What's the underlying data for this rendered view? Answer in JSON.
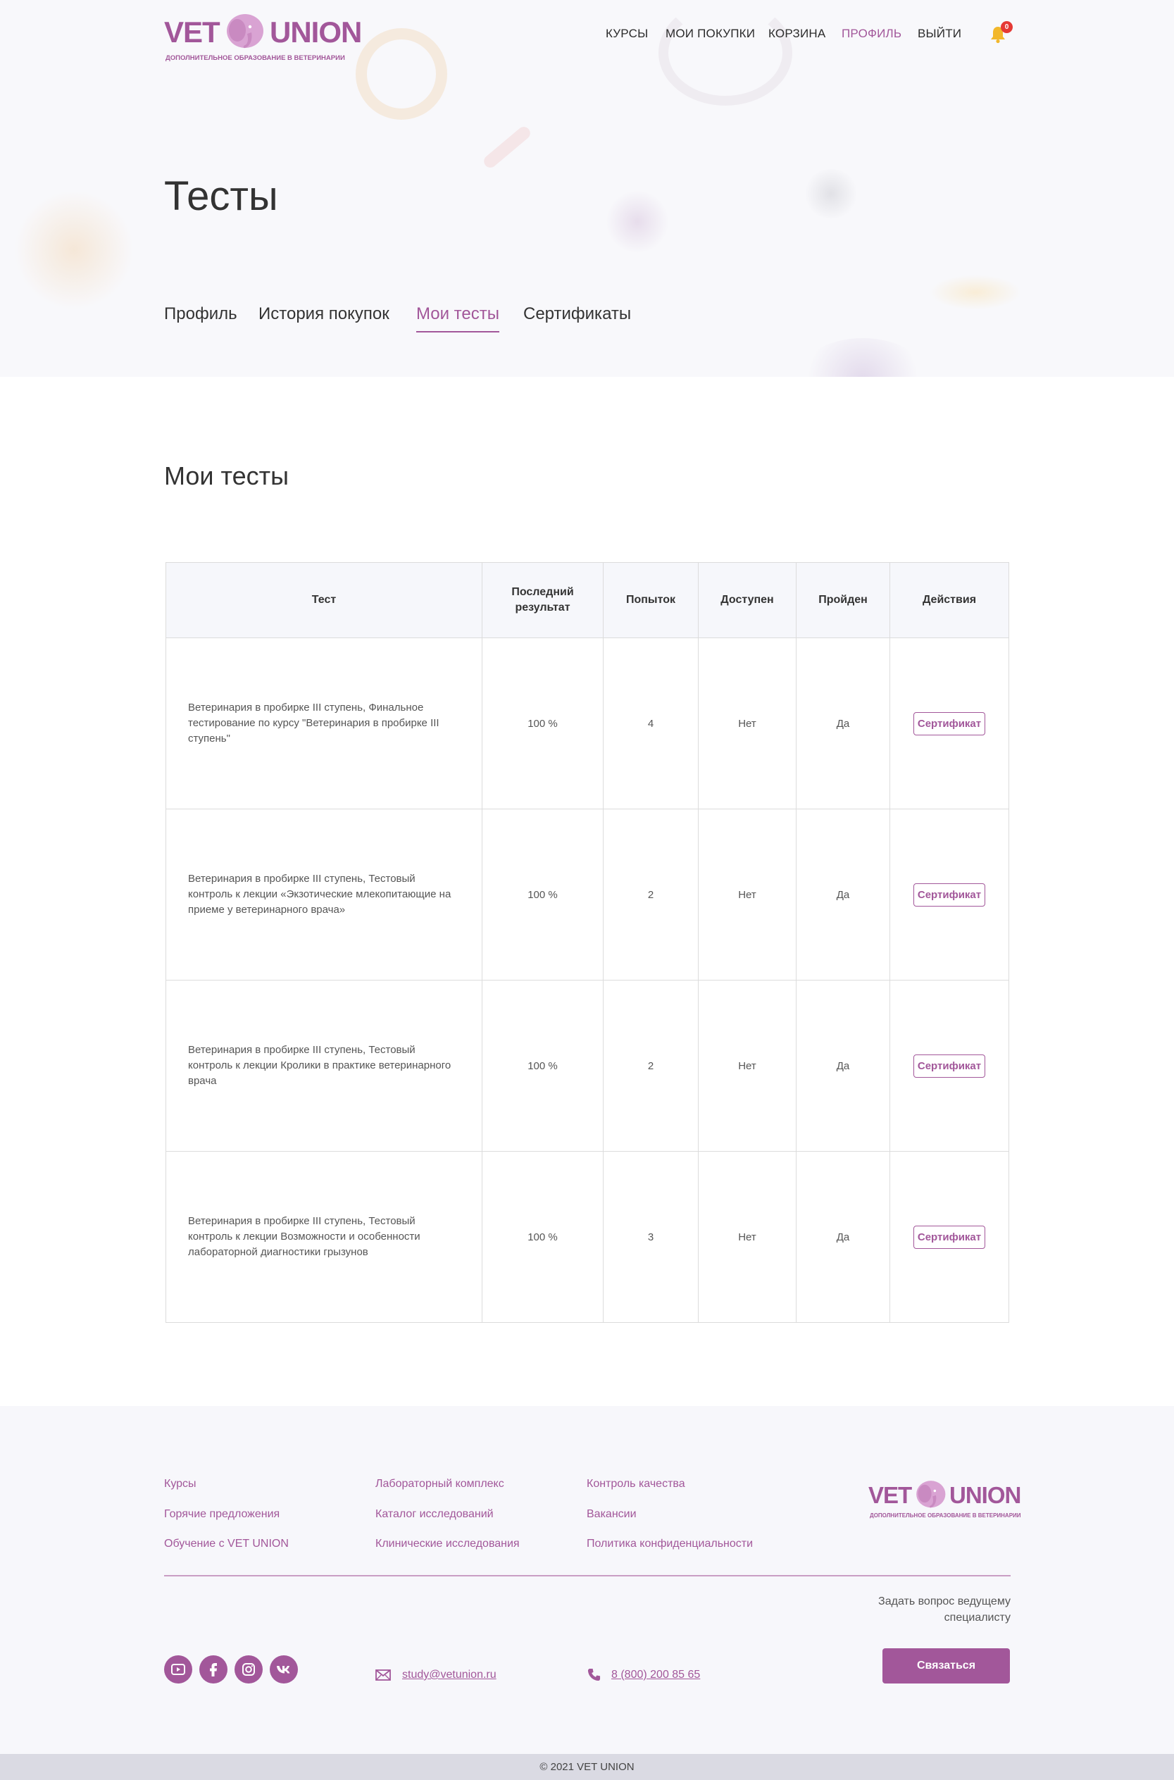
{
  "brand": {
    "logo_word_left": "VET",
    "logo_word_right": "UNION",
    "tagline": "ДОПОЛНИТЕЛЬНОЕ ОБРАЗОВАНИЕ В ВЕТЕРИНАРИИ",
    "color": "#a2579a"
  },
  "nav": {
    "items": [
      {
        "label": "КУРСЫ"
      },
      {
        "label": "МОИ ПОКУПКИ"
      },
      {
        "label": "КОРЗИНА"
      },
      {
        "label": "ПРОФИЛЬ",
        "active": true
      },
      {
        "label": "ВЫЙТИ"
      }
    ],
    "notifications": {
      "icon": "bell-icon",
      "count": "0"
    }
  },
  "page": {
    "title": "Тесты",
    "tabs": [
      {
        "label": "Профиль"
      },
      {
        "label": "История покупок"
      },
      {
        "label": "Мои тесты",
        "active": true
      },
      {
        "label": "Сертификаты"
      }
    ],
    "section_title": "Мои тесты"
  },
  "table": {
    "headers": [
      "Тест",
      "Последний результат",
      "Попыток",
      "Доступен",
      "Пройден",
      "Действия"
    ],
    "rows": [
      {
        "test": "Ветеринария в пробирке III ступень, Финальное тестирование по курсу \"Ветеринария в пробирке III ступень\"",
        "result": "100 %",
        "attempts": "4",
        "available": "Нет",
        "passed": "Да",
        "action": "Сертификат"
      },
      {
        "test": "Ветеринария в пробирке III ступень, Тестовый контроль к лекции «Экзотические млекопитающие на приеме у ветеринарного врача»",
        "result": "100 %",
        "attempts": "2",
        "available": "Нет",
        "passed": "Да",
        "action": "Сертификат"
      },
      {
        "test": "Ветеринария в пробирке III ступень, Тестовый контроль к лекции Кролики в практике ветеринарного врача",
        "result": "100 %",
        "attempts": "2",
        "available": "Нет",
        "passed": "Да",
        "action": "Сертификат"
      },
      {
        "test": "Ветеринария в пробирке III ступень, Тестовый контроль к лекции Возможности и особенности лабораторной диагностики грызунов",
        "result": "100 %",
        "attempts": "3",
        "available": "Нет",
        "passed": "Да",
        "action": "Сертификат"
      }
    ]
  },
  "footer": {
    "col1": [
      "Курсы",
      "Горячие предложения",
      "Обучение с VET UNION"
    ],
    "col2": [
      "Лабораторный комплекс",
      "Каталог исследований",
      "Клинические исследования"
    ],
    "col3": [
      "Контроль качества",
      "Вакансии",
      "Политика конфиденциальности"
    ],
    "ask_text": "Задать вопрос ведущему специалисту",
    "contact_button": "Связаться",
    "social": [
      "youtube-icon",
      "facebook-icon",
      "instagram-icon",
      "vk-icon"
    ],
    "email": "study@vetunion.ru",
    "phone": "8 (800) 200 85 65",
    "copyright": "© 2021 VET UNION"
  }
}
